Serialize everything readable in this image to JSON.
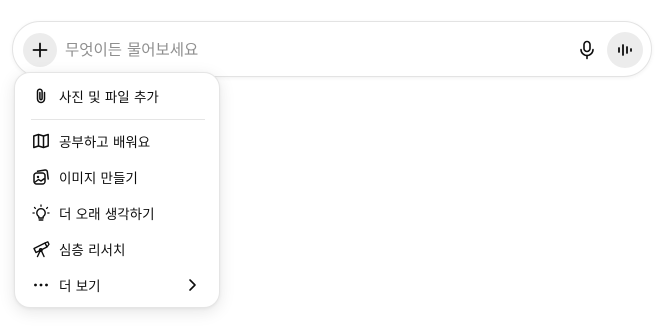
{
  "composer": {
    "placeholder": "무엇이든 물어보세요",
    "value": ""
  },
  "menu": {
    "items": [
      {
        "label": "사진 및 파일 추가",
        "icon": "paperclip-icon"
      },
      {
        "label": "공부하고 배워요",
        "icon": "open-book-icon"
      },
      {
        "label": "이미지 만들기",
        "icon": "image-stack-icon"
      },
      {
        "label": "더 오래 생각하기",
        "icon": "lightbulb-icon"
      },
      {
        "label": "심층 리서치",
        "icon": "telescope-icon"
      },
      {
        "label": "더 보기",
        "icon": "ellipsis-icon"
      }
    ]
  },
  "colors": {
    "accent_bg": "#ececec",
    "text": "#0d0d0d",
    "placeholder": "#8f8f8f",
    "border": "#e3e3e3"
  }
}
